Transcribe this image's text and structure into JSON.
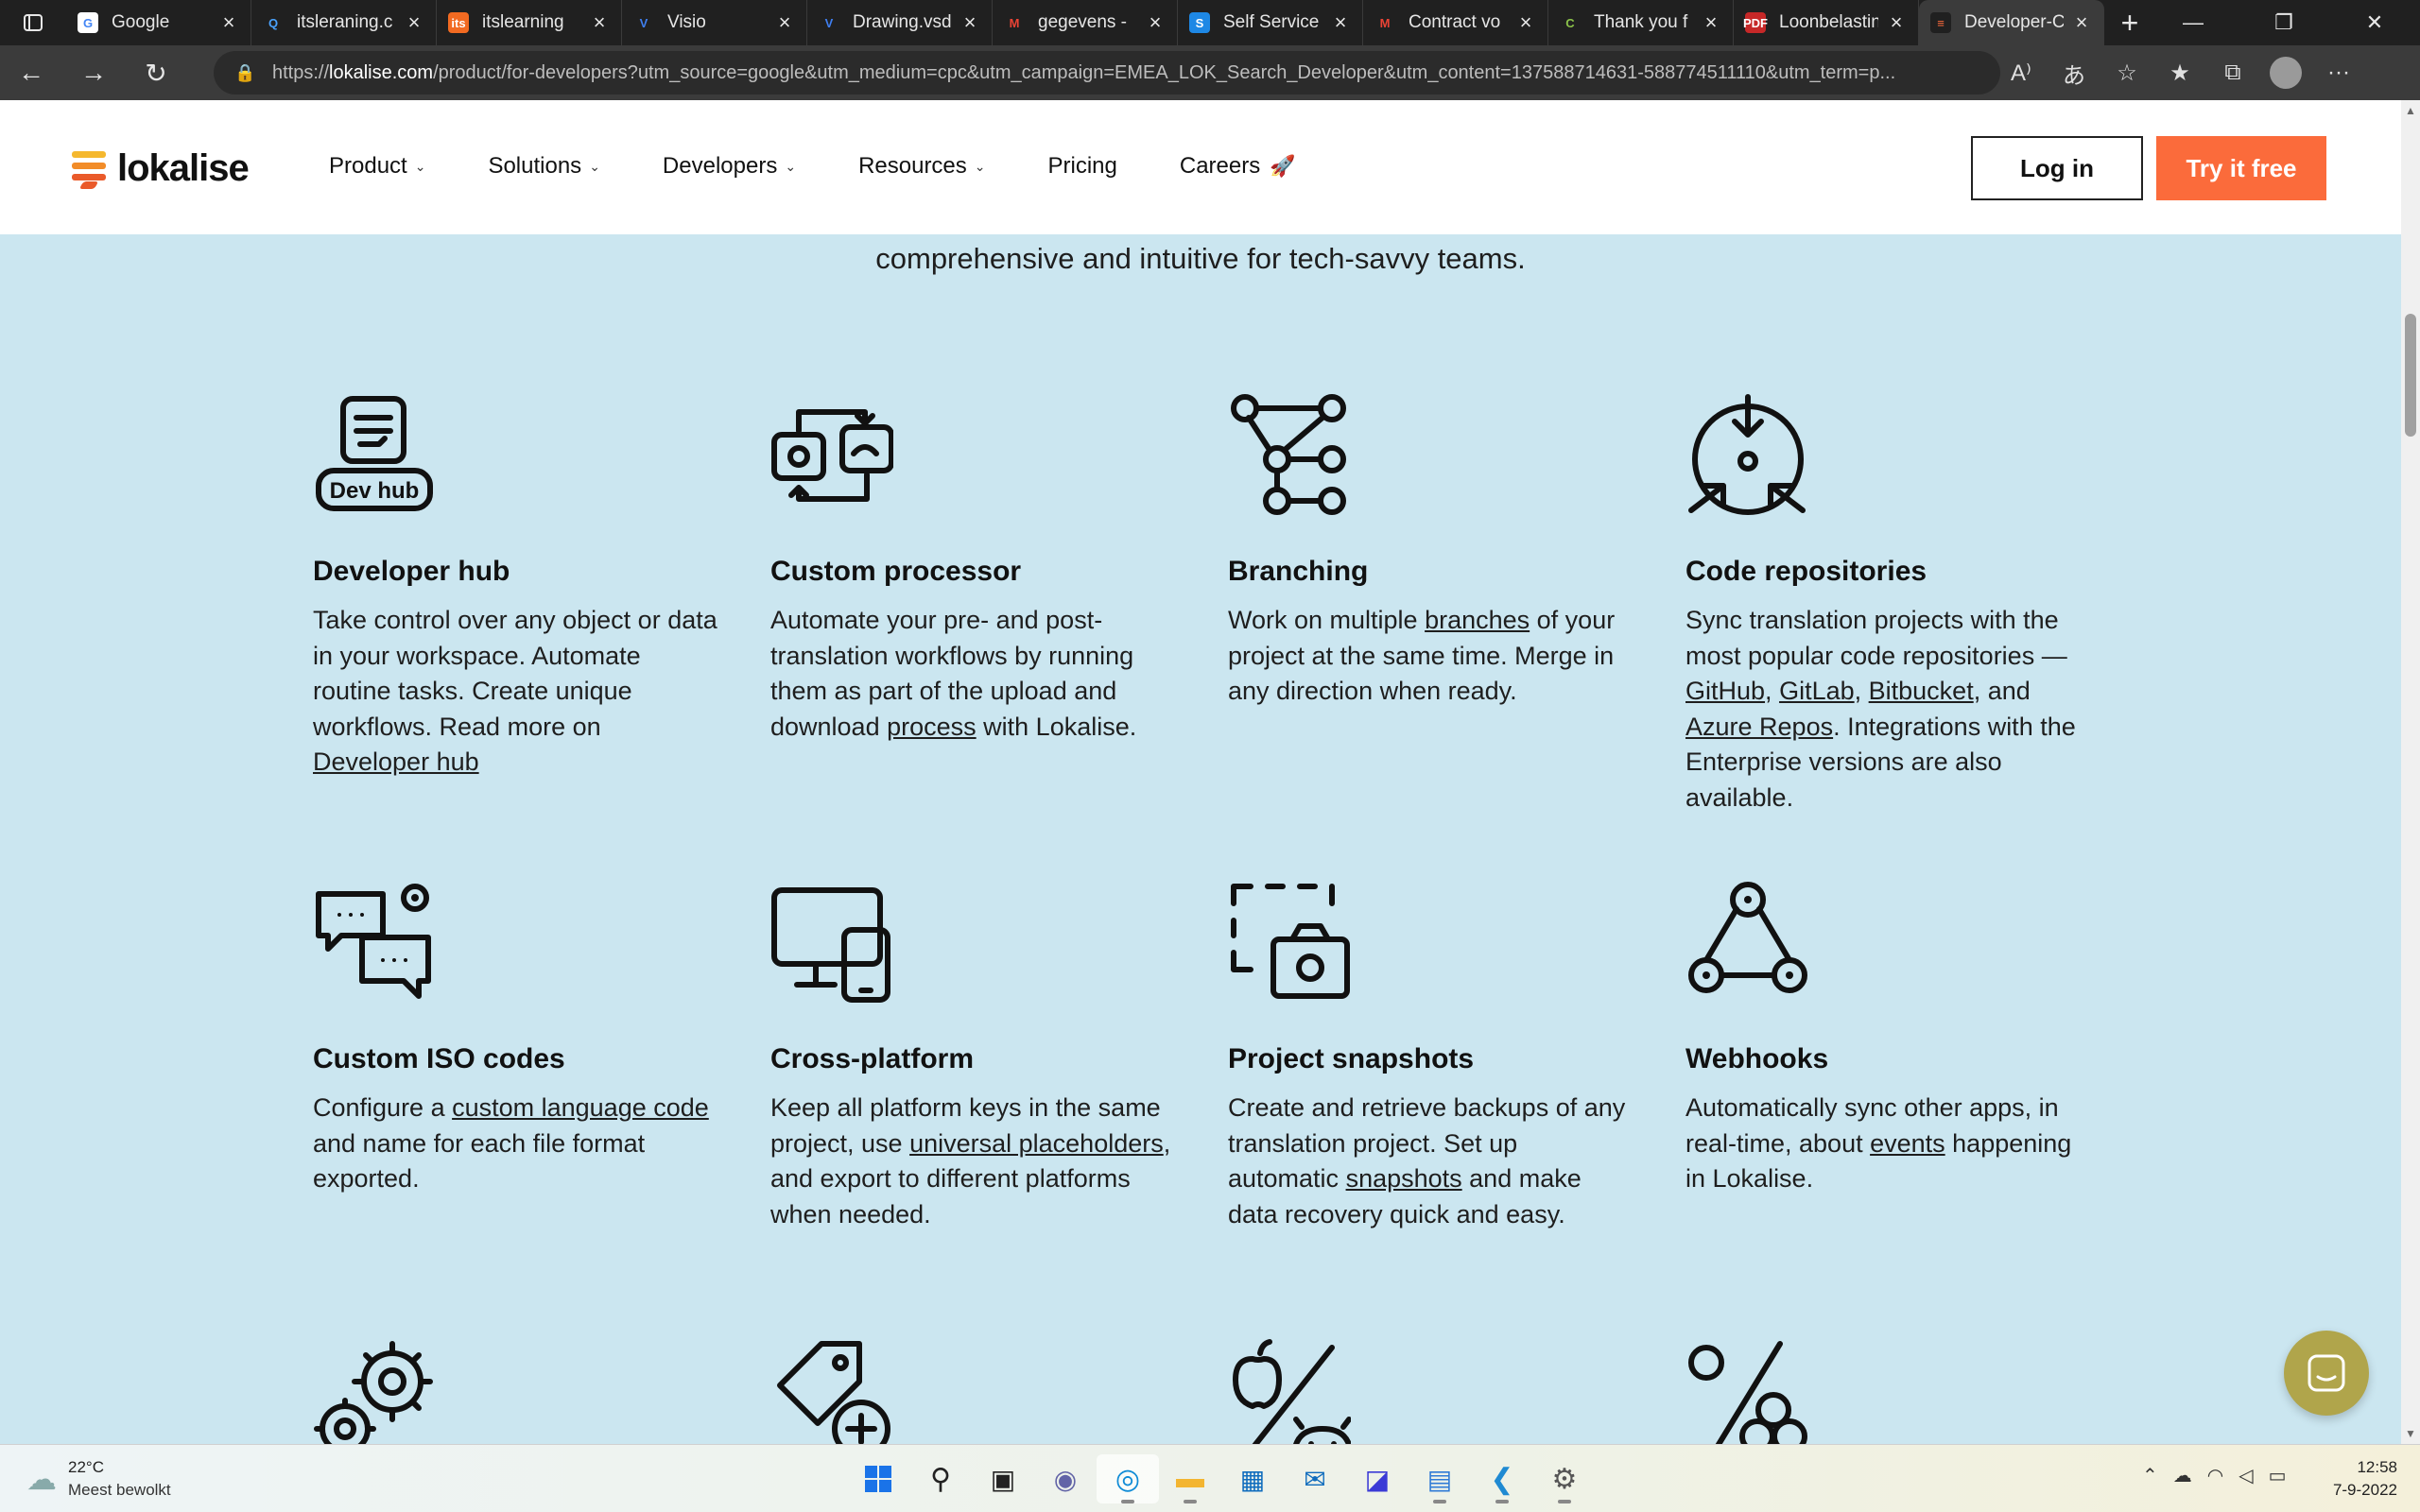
{
  "browser": {
    "tabs": [
      {
        "title": "Google",
        "favicon_color": "#ffffff",
        "favicon_glyph": "G",
        "glyph_color": "#4285f4"
      },
      {
        "title": "itsleraning.c",
        "favicon_color": "#202020",
        "favicon_glyph": "Q",
        "glyph_color": "#4aa3ff"
      },
      {
        "title": "itslearning",
        "favicon_color": "#f26a21",
        "favicon_glyph": "its",
        "glyph_color": "#ffffff"
      },
      {
        "title": "Visio",
        "favicon_color": "#202020",
        "favicon_glyph": "V",
        "glyph_color": "#3f7ff0"
      },
      {
        "title": "Drawing.vsd",
        "favicon_color": "#202020",
        "favicon_glyph": "V",
        "glyph_color": "#3f7ff0"
      },
      {
        "title": "gegevens - ",
        "favicon_color": "#202020",
        "favicon_glyph": "M",
        "glyph_color": "#ea4335"
      },
      {
        "title": "Self Service",
        "favicon_color": "#1e88e5",
        "favicon_glyph": "S",
        "glyph_color": "#ffffff"
      },
      {
        "title": "Contract vo",
        "favicon_color": "#202020",
        "favicon_glyph": "M",
        "glyph_color": "#ea4335"
      },
      {
        "title": "Thank you f",
        "favicon_color": "#202020",
        "favicon_glyph": "C",
        "glyph_color": "#8bc34a"
      },
      {
        "title": "Loonbelastin",
        "favicon_color": "#c62828",
        "favicon_glyph": "PDF",
        "glyph_color": "#ffffff"
      },
      {
        "title": "Developer-C",
        "favicon_color": "#202020",
        "favicon_glyph": "≡",
        "glyph_color": "#fb6b3b",
        "active": true
      }
    ],
    "new_tab_label": "+",
    "url_prefix": "https://",
    "url_domain": "lokalise.com",
    "url_rest": "/product/for-developers?utm_source=google&utm_medium=cpc&utm_campaign=EMEA_LOK_Search_Developer&utm_content=137588714631-588774511110&utm_term=p..."
  },
  "site": {
    "logo_text": "lokalise",
    "nav": [
      {
        "label": "Product",
        "dropdown": true
      },
      {
        "label": "Solutions",
        "dropdown": true
      },
      {
        "label": "Developers",
        "dropdown": true
      },
      {
        "label": "Resources",
        "dropdown": true
      },
      {
        "label": "Pricing",
        "dropdown": false
      },
      {
        "label": "Careers",
        "dropdown": false,
        "emoji": "🚀"
      }
    ],
    "login_label": "Log in",
    "try_label": "Try it free",
    "accent_color": "#fb6b3b"
  },
  "intro_text": "comprehensive and intuitive for tech-savvy teams.",
  "features": [
    {
      "title": "Developer hub",
      "icon": "dev-hub-icon",
      "icon_text": "Dev hub",
      "parts": [
        [
          "Take control over any object or data in your workspace. Automate routine tasks. Create unique workflows. Read more on ",
          false
        ],
        [
          "Developer hub",
          true
        ]
      ]
    },
    {
      "title": "Custom processor",
      "icon": "custom-processor-icon",
      "parts": [
        [
          "Automate your pre- and post-translation workflows by running them as part of the upload and download ",
          false
        ],
        [
          "process",
          true
        ],
        [
          " with Lokalise.",
          false
        ]
      ]
    },
    {
      "title": "Branching",
      "icon": "branching-icon",
      "parts": [
        [
          "Work on multiple ",
          false
        ],
        [
          "branches",
          true
        ],
        [
          " of your project at the same time. Merge in any direction when ready.",
          false
        ]
      ]
    },
    {
      "title": "Code repositories",
      "icon": "code-repositories-icon",
      "parts": [
        [
          "Sync translation projects with the most popular code repositories — ",
          false
        ],
        [
          "GitHub",
          true
        ],
        [
          ", ",
          false
        ],
        [
          "GitLab",
          true
        ],
        [
          ", ",
          false
        ],
        [
          "Bitbucket",
          true
        ],
        [
          ", and ",
          false
        ],
        [
          "Azure Repos",
          true
        ],
        [
          ". Integrations with the Enterprise versions are also available.",
          false
        ]
      ]
    },
    {
      "title": "Custom ISO codes",
      "icon": "custom-iso-codes-icon",
      "parts": [
        [
          "Configure a ",
          false
        ],
        [
          "custom language code",
          true
        ],
        [
          " and name for each file format exported.",
          false
        ]
      ]
    },
    {
      "title": "Cross-platform",
      "icon": "cross-platform-icon",
      "parts": [
        [
          "Keep all platform keys in the same project, use ",
          false
        ],
        [
          "universal placeholders",
          true
        ],
        [
          ", and export to different platforms when needed.",
          false
        ]
      ]
    },
    {
      "title": "Project snapshots",
      "icon": "project-snapshots-icon",
      "parts": [
        [
          "Create and retrieve backups of any translation project. Set up automatic ",
          false
        ],
        [
          "snapshots",
          true
        ],
        [
          " and make data recovery quick and easy.",
          false
        ]
      ]
    },
    {
      "title": "Webhooks",
      "icon": "webhooks-icon",
      "parts": [
        [
          "Automatically sync other apps, in real-time, about ",
          false
        ],
        [
          "events",
          true
        ],
        [
          " happening in Lokalise.",
          false
        ]
      ]
    }
  ],
  "bottom_icons": [
    "gears-icon",
    "tag-plus-icon",
    "apple-android-icon",
    "percent-icon"
  ],
  "taskbar": {
    "temperature": "22°C",
    "weather_desc": "Meest bewolkt",
    "time": "12:58",
    "date": "7-9-2022"
  }
}
